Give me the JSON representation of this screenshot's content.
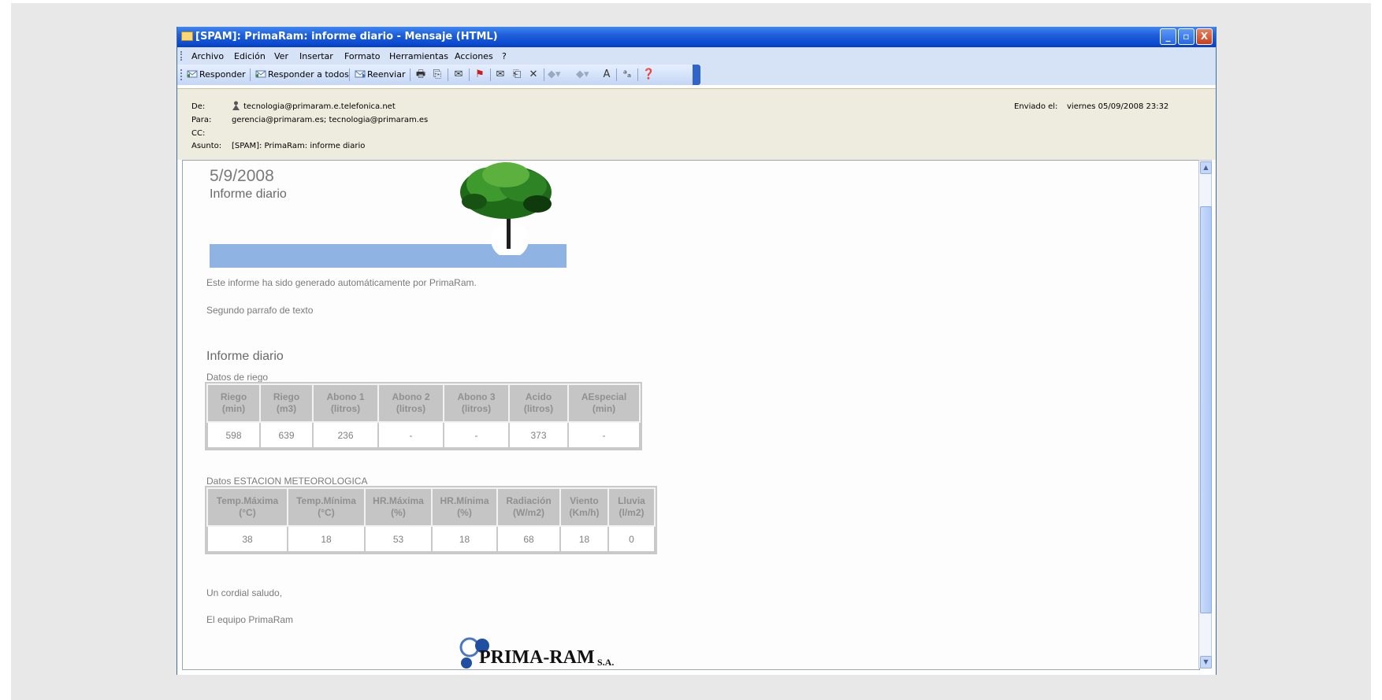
{
  "window": {
    "title": "[SPAM]: PrimaRam: informe diario - Mensaje (HTML)",
    "controls": {
      "minimize": "_",
      "maximize": "▫",
      "close": "X"
    }
  },
  "menu": [
    "Archivo",
    "Edición",
    "Ver",
    "Insertar",
    "Formato",
    "Herramientas",
    "Acciones",
    "?"
  ],
  "toolbar": {
    "reply": "Responder",
    "reply_all": "Responder a todos",
    "forward": "Reenviar",
    "font_size": "A"
  },
  "header": {
    "from_label": "De:",
    "from": "tecnologia@primaram.e.telefonica.net",
    "to_label": "Para:",
    "to": "gerencia@primaram.es; tecnologia@primaram.es",
    "cc_label": "CC:",
    "cc": "",
    "subject_label": "Asunto:",
    "subject": "[SPAM]: PrimaRam: informe diario",
    "sent_label": "Enviado el:",
    "sent": "viernes 05/09/2008 23:32"
  },
  "body": {
    "date": "5/9/2008",
    "subtitle": "Informe diario",
    "intro": "Este informe ha sido generado automáticamente por PrimaRam.",
    "second": "Segundo parrafo de texto",
    "heading": "Informe diario",
    "riego_caption": "Datos de riego",
    "riego_headers": [
      [
        "Riego",
        "(min)"
      ],
      [
        "Riego",
        "(m3)"
      ],
      [
        "Abono 1",
        "(litros)"
      ],
      [
        "Abono 2",
        "(litros)"
      ],
      [
        "Abono 3",
        "(litros)"
      ],
      [
        "Acido",
        "(litros)"
      ],
      [
        "AEspecial",
        "(min)"
      ]
    ],
    "riego_values": [
      "598",
      "639",
      "236",
      "-",
      "-",
      "373",
      "-"
    ],
    "meteo_caption": "Datos ESTACION METEOROLOGICA",
    "meteo_headers": [
      [
        "Temp.Máxima",
        "(°C)"
      ],
      [
        "Temp.Mínima",
        "(°C)"
      ],
      [
        "HR.Máxima",
        "(%)"
      ],
      [
        "HR.Mínima",
        "(%)"
      ],
      [
        "Radiación",
        "(W/m2)"
      ],
      [
        "Viento",
        "(Km/h)"
      ],
      [
        "Lluvia",
        "(l/m2)"
      ]
    ],
    "meteo_values": [
      "38",
      "18",
      "53",
      "18",
      "68",
      "18",
      "0"
    ],
    "closing": "Un cordial saludo,",
    "signature": "El equipo PrimaRam",
    "logo_text": "PRIMA-RAM",
    "logo_suffix": "S.A."
  },
  "colors": {
    "title_bar": "#0a4ad0",
    "banner": "#8fb4e3",
    "header_bg": "#eeecdf",
    "table_header": "#c5c5c5"
  }
}
